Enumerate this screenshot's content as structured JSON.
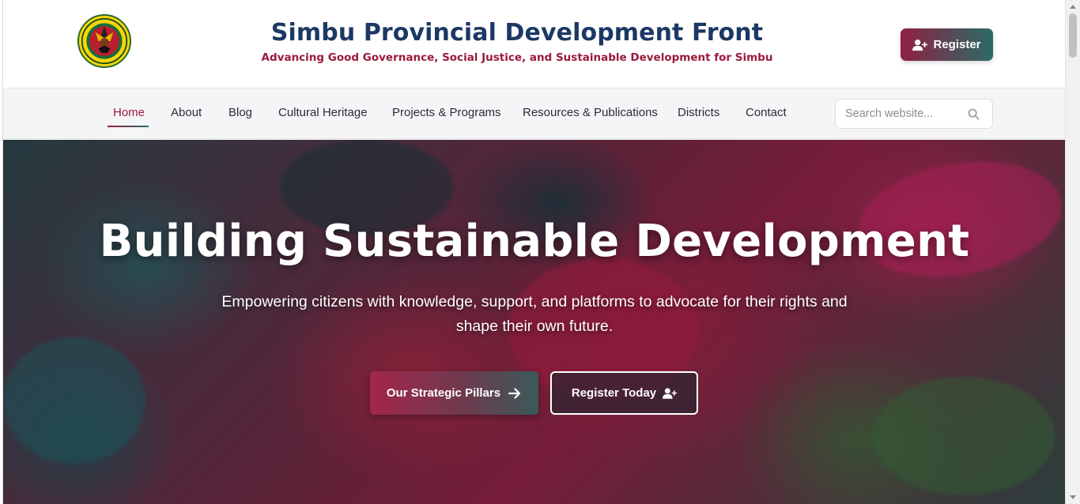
{
  "header": {
    "logo_name": "simbu-emblem-logo",
    "title": "Simbu Provincial Development Front",
    "tagline": "Advancing Good Governance, Social Justice, and Sustainable Development for Simbu",
    "register_label": "Register"
  },
  "nav": {
    "items": [
      {
        "label": "Home",
        "active": true
      },
      {
        "label": "About"
      },
      {
        "label": "Blog"
      },
      {
        "label": "Cultural Heritage"
      },
      {
        "label": "Projects & Programs"
      },
      {
        "label": "Resources & Publications"
      },
      {
        "label": "Districts"
      },
      {
        "label": "Contact"
      }
    ],
    "search_placeholder": "Search website..."
  },
  "hero": {
    "title": "Building Sustainable Development",
    "subtitle": "Empowering citizens with knowledge, support, and platforms to advocate for their rights and shape their own future.",
    "primary_button": "Our Strategic Pillars",
    "secondary_button": "Register Today"
  },
  "colors": {
    "brand_navy": "#1c3864",
    "brand_crimson": "#9b1b3c",
    "brand_teal": "#2b6b66"
  },
  "icons": {
    "register": "user-plus-icon",
    "search": "search-icon",
    "arrow": "arrow-right-icon"
  }
}
